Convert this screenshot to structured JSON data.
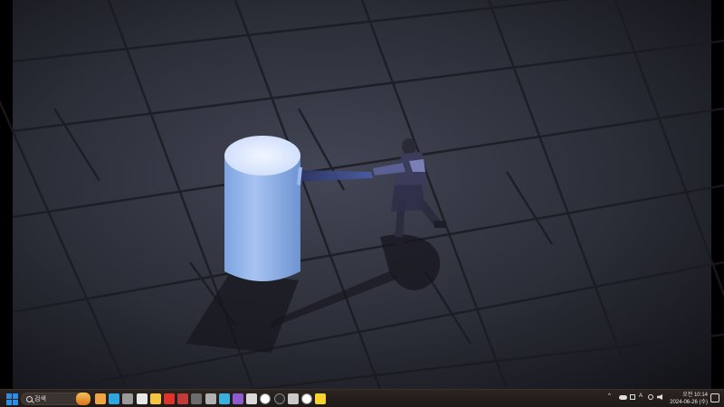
{
  "taskbar": {
    "search_placeholder": "검색",
    "apps": [
      {
        "icon": "game-launcher-icon",
        "color": "#f0a640"
      },
      {
        "icon": "edge-icon",
        "color": "#2fa6e0"
      },
      {
        "icon": "calculator-icon",
        "color": "#9a9a9a"
      },
      {
        "icon": "app-grid-icon",
        "color": "#e7e7e7"
      },
      {
        "icon": "file-explorer-icon",
        "color": "#f5c542"
      },
      {
        "icon": "search-tool-icon",
        "color": "#e2332a"
      },
      {
        "icon": "screen-recorder-icon",
        "color": "#c43a3a"
      },
      {
        "icon": "media-icon",
        "color": "#6c6c6c"
      },
      {
        "icon": "microphone-icon",
        "color": "#b0b0b0"
      },
      {
        "icon": "photos-icon",
        "color": "#3ab0e0"
      },
      {
        "icon": "visual-studio-icon",
        "color": "#8e5bd0"
      },
      {
        "icon": "notes-icon",
        "color": "#d9d9d9"
      },
      {
        "icon": "unreal-engine-icon",
        "color": "#ffffff"
      },
      {
        "icon": "unreal-project-icon",
        "color": "#2a2a2a"
      },
      {
        "icon": "settings-icon",
        "color": "#c9c9c9"
      },
      {
        "icon": "unreal-engine-editor-icon",
        "color": "#ffffff"
      },
      {
        "icon": "chat-icon",
        "color": "#f6d32d"
      }
    ],
    "tray": {
      "chevron": "^",
      "ime_label": "A",
      "clock_time": "오전 10:14",
      "clock_date": "2024-06-26 (수)"
    }
  },
  "colors": {
    "floor": "#2a2d38",
    "pillar": "#8ab0ea",
    "character": "#3a3a52"
  }
}
